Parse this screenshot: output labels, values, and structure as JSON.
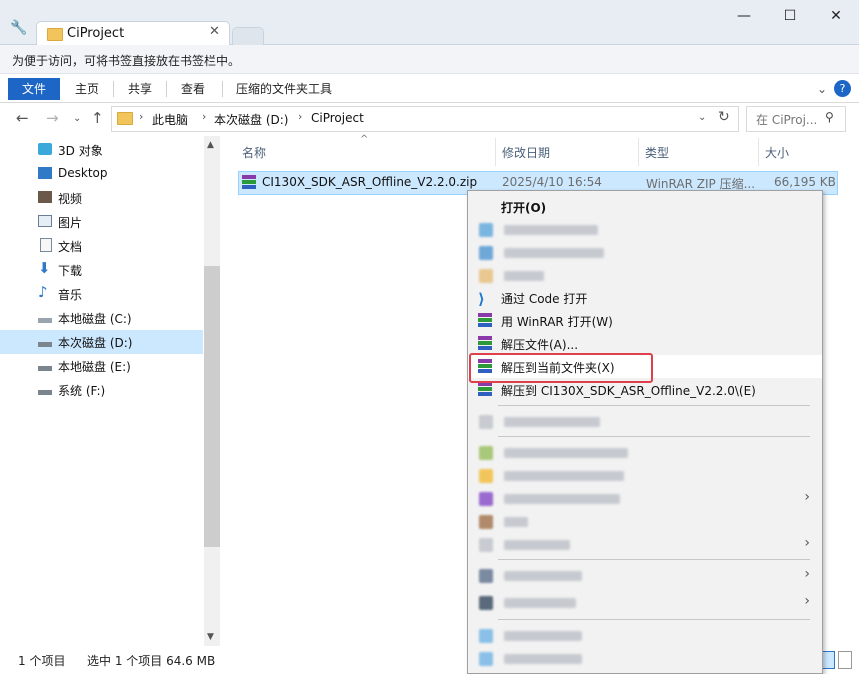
{
  "window": {
    "tab_title": "CiProject",
    "tab_close": "✕",
    "minimize": "—",
    "maximize": "☐",
    "close": "✕"
  },
  "bookmark_bar": {
    "text": "为便于访问，可将书签直接放在书签栏中。"
  },
  "ribbon": {
    "tabs": [
      "文件",
      "主页",
      "共享",
      "查看",
      "压缩的文件夹工具"
    ],
    "expand": "⌄",
    "help": "?"
  },
  "address": {
    "crumbs": [
      "此电脑",
      "本次磁盘 (D:)",
      "CiProject"
    ],
    "search_placeholder": "在 CiProj..."
  },
  "nav_pane": {
    "items": [
      {
        "label": "3D 对象",
        "icon": "cube-3d-icon"
      },
      {
        "label": "Desktop",
        "icon": "desktop-icon"
      },
      {
        "label": "视频",
        "icon": "video-icon"
      },
      {
        "label": "图片",
        "icon": "pictures-icon"
      },
      {
        "label": "文档",
        "icon": "document-icon"
      },
      {
        "label": "下载",
        "icon": "download-icon"
      },
      {
        "label": "音乐",
        "icon": "music-icon"
      },
      {
        "label": "本地磁盘 (C:)",
        "icon": "drive-icon"
      },
      {
        "label": "本次磁盘 (D:)",
        "icon": "drive-icon",
        "selected": true
      },
      {
        "label": "本地磁盘 (E:)",
        "icon": "drive-icon"
      },
      {
        "label": "系统 (F:)",
        "icon": "drive-icon"
      }
    ]
  },
  "file_list": {
    "columns": [
      "名称",
      "修改日期",
      "类型",
      "大小"
    ],
    "rows": [
      {
        "name": "CI130X_SDK_ASR_Offline_V2.2.0.zip",
        "date": "2025/4/10 16:54",
        "type": "WinRAR ZIP 压缩...",
        "size": "66,195 KB"
      }
    ]
  },
  "status_bar": {
    "count": "1 个项目",
    "selected": "选中 1 个项目  64.6 MB"
  },
  "context_menu": {
    "open": "打开(O)",
    "vscode": "通过 Code 打开",
    "winrar_open": "用 WinRAR 打开(W)",
    "extract_files": "解压文件(A)...",
    "extract_here": "解压到当前文件夹(X)",
    "extract_to": "解压到 CI130X_SDK_ASR_Offline_V2.2.0\\(E)",
    "submenu_arrow": "›"
  },
  "colors": {
    "accent": "#1e66c6",
    "selection": "#cce8ff",
    "highlight_border": "#e0404c"
  }
}
